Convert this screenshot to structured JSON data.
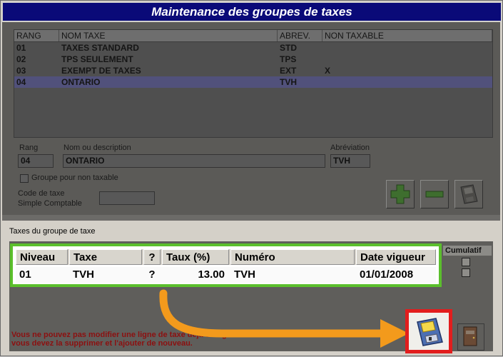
{
  "title": "Maintenance des groupes de taxes",
  "groups_table": {
    "headers": [
      "RANG",
      "NOM TAXE",
      "ABREV.",
      "NON TAXABLE"
    ],
    "rows": [
      {
        "rang": "01",
        "nom": "TAXES STANDARD",
        "abrev": "STD",
        "non_taxable": ""
      },
      {
        "rang": "02",
        "nom": "TPS SEULEMENT",
        "abrev": "TPS",
        "non_taxable": ""
      },
      {
        "rang": "03",
        "nom": "EXEMPT DE TAXES",
        "abrev": "EXT",
        "non_taxable": "X"
      },
      {
        "rang": "04",
        "nom": "ONTARIO",
        "abrev": "TVH",
        "non_taxable": ""
      }
    ]
  },
  "form": {
    "rang_label": "Rang",
    "rang_value": "04",
    "nom_label": "Nom ou description",
    "nom_value": "ONTARIO",
    "abrev_label": "Abréviation",
    "abrev_value": "TVH",
    "non_taxable_label": "Groupe pour non taxable",
    "code_label_1": "Code de taxe",
    "code_label_2": "Simple Comptable",
    "code_value": ""
  },
  "buttons": {
    "add": "plus-icon",
    "remove": "minus-icon",
    "save": "floppy-disk-icon",
    "exit": "exit-door-icon"
  },
  "taxes_section": {
    "title": "Taxes du groupe de taxe",
    "cumulatif_label": "Cumulatif",
    "headers": [
      "Niveau",
      "Taxe",
      "?",
      "Taux (%)",
      "Numéro",
      "Date vigueur"
    ],
    "rows": [
      {
        "niveau": "01",
        "taxe": "TVH",
        "q": "?",
        "taux": "13.00",
        "numero": "TVH",
        "date": "01/01/2008"
      }
    ]
  },
  "warning": {
    "line1": "Vous ne pouvez pas modifier une ligne de taxe déjà enregistrée",
    "line2": "vous devez la supprimer et l'ajouter de nouveau."
  },
  "colors": {
    "title_bar": "#0a0a78",
    "highlight_green": "#5bbf2c",
    "highlight_red": "#e21d1d",
    "arrow": "#f39a1c",
    "warning_text": "#8c1010"
  }
}
